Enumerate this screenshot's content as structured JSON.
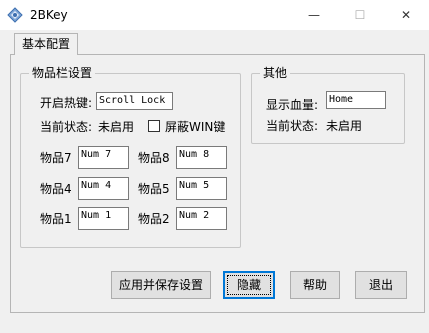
{
  "window": {
    "title": "2BKey",
    "minimize_glyph": "—",
    "maximize_glyph": "☐",
    "close_glyph": "✕"
  },
  "tabs": [
    {
      "label": "基本配置"
    }
  ],
  "items_group": {
    "title": "物品栏设置",
    "hotkey_label": "开启热键:",
    "hotkey_value": "Scroll Lock",
    "status_label": "当前状态:",
    "status_value": "未启用",
    "block_win_label": "屏蔽WIN键",
    "block_win_checked": false,
    "slots": [
      {
        "label": "物品7",
        "value": "Num 7"
      },
      {
        "label": "物品8",
        "value": "Num 8"
      },
      {
        "label": "物品4",
        "value": "Num 4"
      },
      {
        "label": "物品5",
        "value": "Num 5"
      },
      {
        "label": "物品1",
        "value": "Num 1"
      },
      {
        "label": "物品2",
        "value": "Num 2"
      }
    ]
  },
  "other_group": {
    "title": "其他",
    "health_label": "显示血量:",
    "health_value": "Home",
    "status_label": "当前状态:",
    "status_value": "未启用"
  },
  "buttons": {
    "apply_save": "应用并保存设置",
    "hide": "隐藏",
    "help": "帮助",
    "exit": "退出"
  },
  "icons": {
    "app": "app-logo-icon",
    "minimize": "minimize-icon",
    "maximize": "maximize-icon",
    "close": "close-icon"
  },
  "colors": {
    "titlebar": "#ffffff",
    "background": "#f0f0f0",
    "focus_border": "#0078d7"
  }
}
